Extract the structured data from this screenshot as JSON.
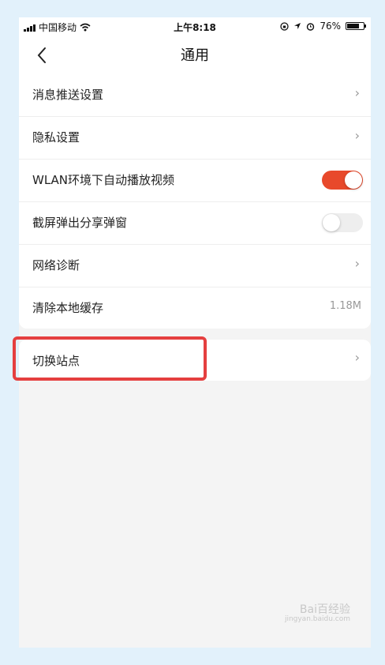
{
  "status_bar": {
    "carrier": "中国移动",
    "time": "上午8:18",
    "battery": "76%",
    "battery_level": 0.76
  },
  "nav": {
    "title": "通用"
  },
  "settings": [
    {
      "label": "消息推送设置",
      "type": "link"
    },
    {
      "label": "隐私设置",
      "type": "link"
    },
    {
      "label": "WLAN环境下自动播放视频",
      "type": "toggle",
      "on": true
    },
    {
      "label": "截屏弹出分享弹窗",
      "type": "toggle",
      "on": false
    },
    {
      "label": "网络诊断",
      "type": "link"
    },
    {
      "label": "清除本地缓存",
      "type": "value",
      "value": "1.18M"
    }
  ],
  "switch_site": {
    "label": "切换站点"
  },
  "colors": {
    "accent": "#e8492b",
    "highlight": "#e53f3f",
    "background": "#f4f4f4",
    "outer": "#e2f1fb"
  },
  "watermark": {
    "text": "Bai百经验",
    "sub": "jingyan.baidu.com"
  }
}
